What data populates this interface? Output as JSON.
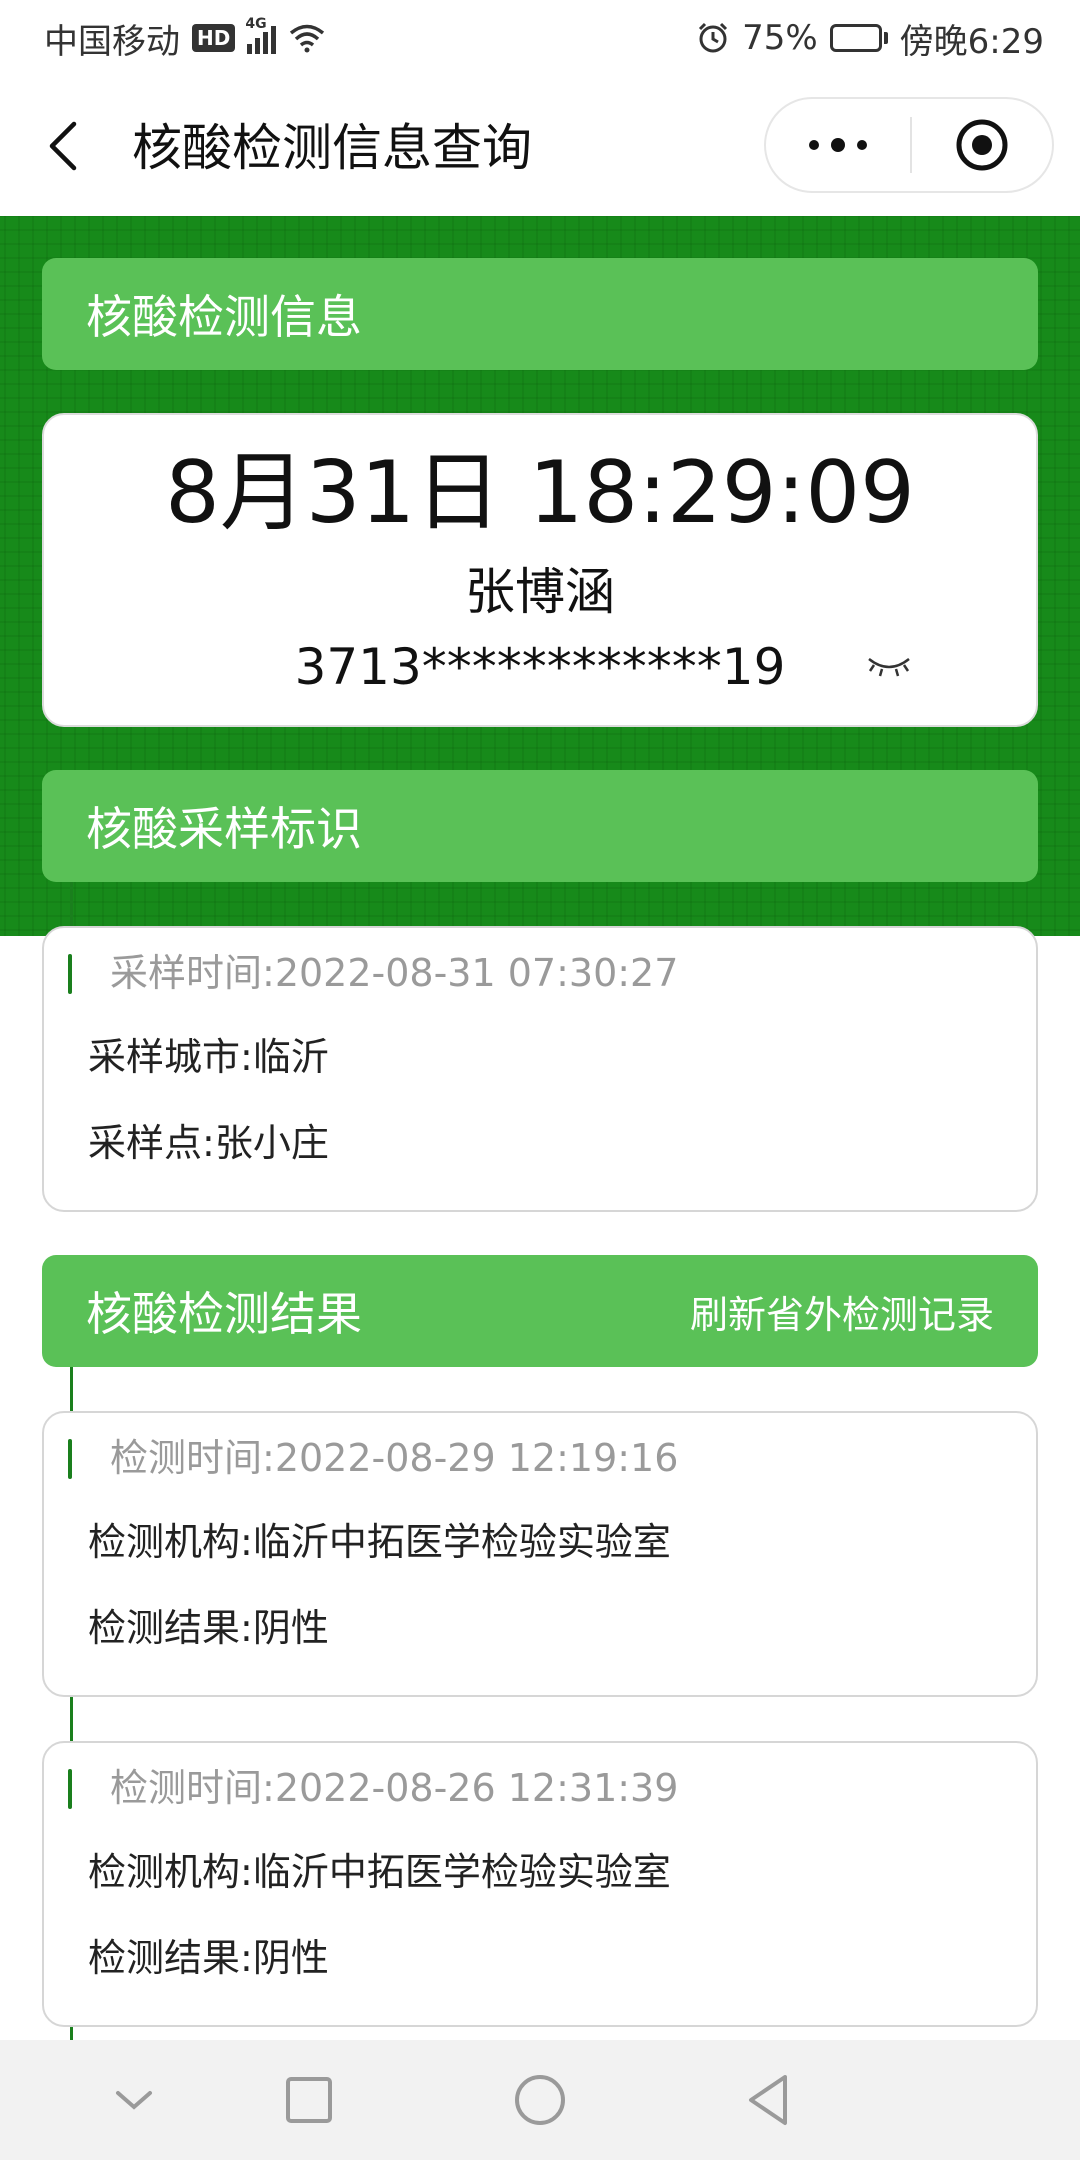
{
  "status_bar": {
    "carrier": "中国移动",
    "hd_badge": "HD",
    "network": "4G",
    "battery_percent": "75%",
    "battery_level": 0.75,
    "time": "傍晚6:29"
  },
  "nav": {
    "title": "核酸检测信息查询"
  },
  "info_section": {
    "title": "核酸检测信息",
    "datetime": "8月31日 18:29:09",
    "name": "张博涵",
    "id_number": "3713************19"
  },
  "sampling_section": {
    "title": "核酸采样标识",
    "time_label": "采样时间:",
    "time_value": "2022-08-31 07:30:27",
    "city_label": "采样城市:",
    "city_value": "临沂",
    "site_label": "采样点:",
    "site_value": "张小庄"
  },
  "results_section": {
    "title": "核酸检测结果",
    "refresh_label": "刷新省外检测记录",
    "records": [
      {
        "time_label": "检测时间:",
        "time_value": "2022-08-29 12:19:16",
        "org_label": "检测机构:",
        "org_value": "临沂中拓医学检验实验室",
        "result_label": "检测结果:",
        "result_value": "阴性"
      },
      {
        "time_label": "检测时间:",
        "time_value": "2022-08-26 12:31:39",
        "org_label": "检测机构:",
        "org_value": "临沂中拓医学检验实验室",
        "result_label": "检测结果:",
        "result_value": "阴性"
      }
    ]
  },
  "colors": {
    "header_green": "#5ac157",
    "background_green": "#178a1a",
    "timeline_green": "#1a7f1d"
  },
  "icons": {
    "back": "back-arrow-icon",
    "more": "more-dots-icon",
    "close": "target-circle-icon",
    "eye": "eye-closed-icon",
    "sys_down": "chevron-down-icon",
    "sys_recent": "square-icon",
    "sys_home": "circle-icon",
    "sys_back": "triangle-back-icon"
  }
}
